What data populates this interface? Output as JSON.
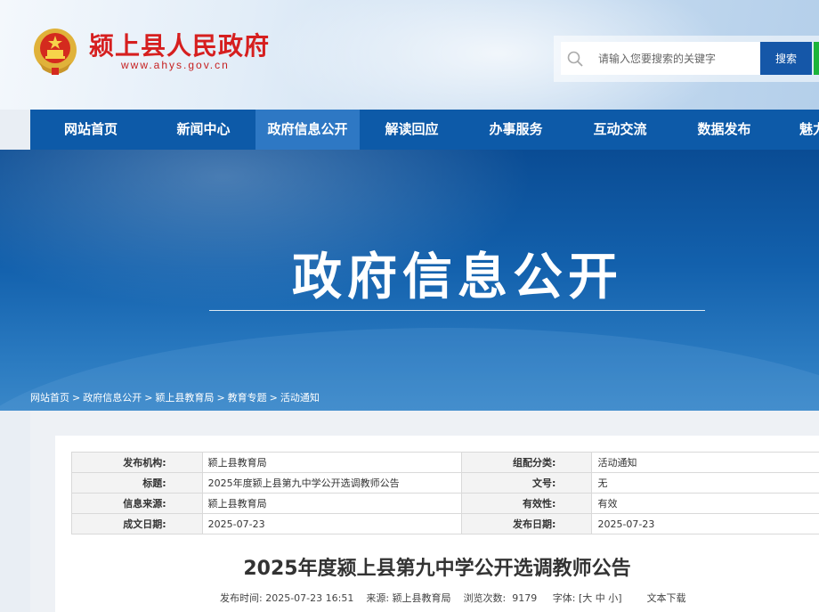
{
  "header": {
    "site_title": "颍上县人民政府",
    "site_url": "www.ahys.gov.cn",
    "search_placeholder": "请输入您要搜索的关键字",
    "search_button": "搜索"
  },
  "nav": {
    "items": [
      "网站首页",
      "新闻中心",
      "政府信息公开",
      "解读回应",
      "办事服务",
      "互动交流",
      "数据发布",
      "魅力"
    ],
    "active_index": 2
  },
  "banner": {
    "title": "政府信息公开"
  },
  "breadcrumb": [
    "网站首页",
    "政府信息公开",
    "颍上县教育局",
    "教育专题",
    "活动通知"
  ],
  "breadcrumb_sep": ">",
  "meta": {
    "rows": [
      [
        {
          "k": "发布机构:",
          "v": "颍上县教育局"
        },
        {
          "k": "组配分类:",
          "v": "活动通知"
        }
      ],
      [
        {
          "k": "标题:",
          "v": "2025年度颍上县第九中学公开选调教师公告"
        },
        {
          "k": "文号:",
          "v": "无"
        }
      ],
      [
        {
          "k": "信息来源:",
          "v": "颍上县教育局"
        },
        {
          "k": "有效性:",
          "v": "有效"
        }
      ],
      [
        {
          "k": "成文日期:",
          "v": "2025-07-23"
        },
        {
          "k": "发布日期:",
          "v": "2025-07-23"
        }
      ]
    ]
  },
  "document": {
    "title": "2025年度颍上县第九中学公开选调教师公告",
    "publish_label": "发布时间:",
    "publish_time": "2025-07-23 16:51",
    "source_label": "来源:",
    "source": "颍上县教育局",
    "views_label": "浏览次数:",
    "views": "9179",
    "font_label": "字体:",
    "font_open": "[",
    "font_large": "大",
    "font_medium": "中",
    "font_small": "小",
    "font_close": "]",
    "download": "文本下载"
  },
  "colors": {
    "nav_bg": "#0d5aa8",
    "nav_active": "#2e78c4",
    "title_red": "#d61f1f",
    "search_btn": "#1557a8"
  }
}
